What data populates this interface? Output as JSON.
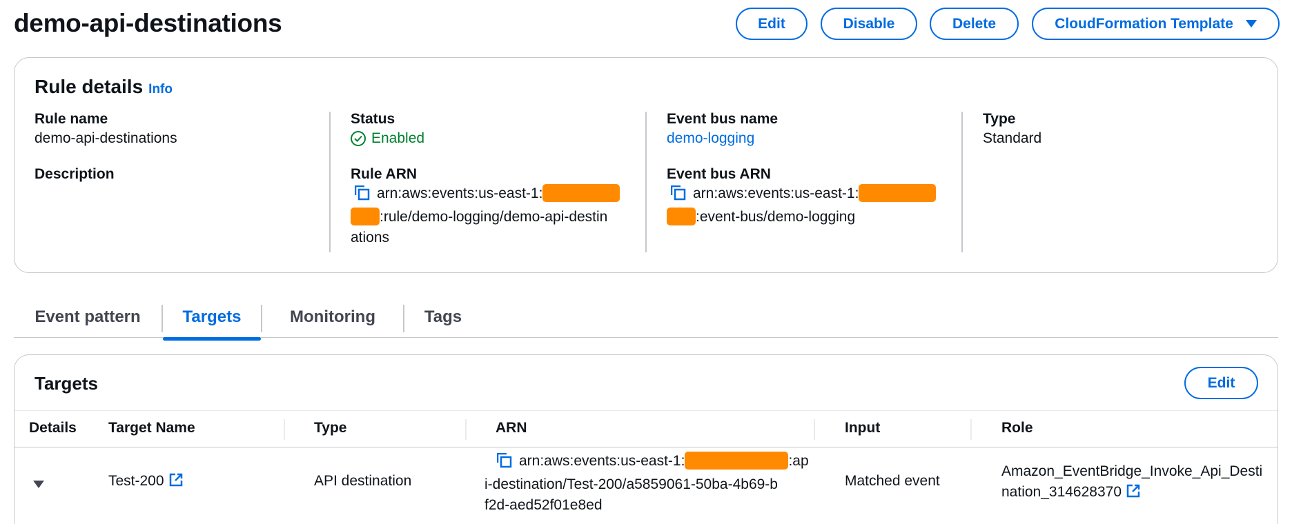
{
  "page": {
    "title": "demo-api-destinations",
    "actions": {
      "edit": "Edit",
      "disable": "Disable",
      "delete": "Delete",
      "cloudformation": "CloudFormation Template"
    }
  },
  "rule_details": {
    "heading": "Rule details",
    "info": "Info",
    "rule_name_label": "Rule name",
    "rule_name_value": "demo-api-destinations",
    "description_label": "Description",
    "status_label": "Status",
    "status_value": "Enabled",
    "rule_arn_label": "Rule ARN",
    "rule_arn_part1": "arn:aws:events:us-east-1:",
    "rule_arn_part2": ":rule/demo-logging/demo-api-destin",
    "rule_arn_part3": "ations",
    "event_bus_name_label": "Event bus name",
    "event_bus_name_value": "demo-logging",
    "event_bus_arn_label": "Event bus ARN",
    "event_bus_arn_part1": "arn:aws:events:us-east-1:",
    "event_bus_arn_part2": ":event-bus/demo-logging",
    "type_label": "Type",
    "type_value": "Standard"
  },
  "tabs": [
    {
      "label": "Event pattern",
      "active": false
    },
    {
      "label": "Targets",
      "active": true
    },
    {
      "label": "Monitoring",
      "active": false
    },
    {
      "label": "Tags",
      "active": false
    }
  ],
  "targets": {
    "heading": "Targets",
    "edit_label": "Edit",
    "columns": [
      "Details",
      "Target Name",
      "Type",
      "ARN",
      "Input",
      "Role"
    ],
    "rows": [
      {
        "target_name": "Test-200",
        "type": "API destination",
        "arn_part1": "arn:aws:events:us-east-1:",
        "arn_part2": ":ap",
        "arn_part3": "i-destination/Test-200/a5859061-50ba-4b69-b",
        "arn_part4": "f2d-aed52f01e8ed",
        "input": "Matched event",
        "role_line1": "Amazon_EventBridge_Invoke_Api_Desti",
        "role_line2": "nation_314628370"
      }
    ]
  },
  "colors": {
    "accent": "#006ce0",
    "success": "#00802f",
    "redaction": "#ff8a00",
    "border": "#c6c6cd"
  },
  "icons": [
    "copy-icon",
    "external-link-icon",
    "check-circle-icon",
    "caret-down-icon"
  ]
}
